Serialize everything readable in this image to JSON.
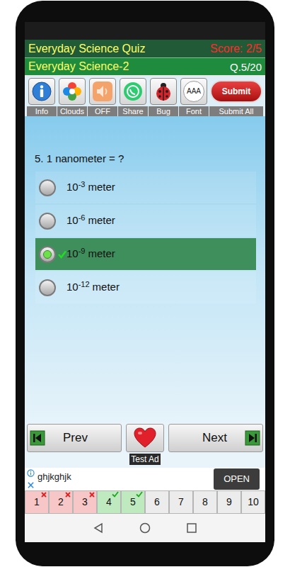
{
  "header": {
    "title": "Everyday Science Quiz",
    "score": "Score: 2/5",
    "subtitle": "Everyday Science-2",
    "progress": "Q.5/20"
  },
  "toolbar": [
    {
      "label": "Info",
      "kind": "info"
    },
    {
      "label": "Clouds",
      "kind": "clouds"
    },
    {
      "label": "OFF",
      "kind": "sound"
    },
    {
      "label": "Share",
      "kind": "share"
    },
    {
      "label": "Bug",
      "kind": "bug"
    },
    {
      "label": "Font",
      "kind": "font",
      "icon_text": "AAA"
    },
    {
      "label": "Submit All",
      "kind": "submit",
      "button_text": "Submit"
    }
  ],
  "question": {
    "text": "5. 1 nanometer = ?",
    "options": [
      {
        "base": "10",
        "exponent": "-3",
        "unit": "meter",
        "selected": false,
        "correct": false
      },
      {
        "base": "10",
        "exponent": "-6",
        "unit": "meter",
        "selected": false,
        "correct": false
      },
      {
        "base": "10",
        "exponent": "-9",
        "unit": "meter",
        "selected": true,
        "correct": true
      },
      {
        "base": "10",
        "exponent": "-12",
        "unit": "meter",
        "selected": false,
        "correct": false
      }
    ]
  },
  "nav": {
    "prev": "Prev",
    "next": "Next"
  },
  "ad": {
    "label": "Test Ad",
    "text": "ghjkghjk",
    "button": "OPEN"
  },
  "questions": [
    {
      "number": "1",
      "kind": "wrong"
    },
    {
      "number": "2",
      "kind": "wrong"
    },
    {
      "number": "3",
      "kind": "wrong"
    },
    {
      "number": "4",
      "kind": "correct"
    },
    {
      "number": "5",
      "kind": "correct"
    },
    {
      "number": "6",
      "kind": "unanswered"
    },
    {
      "number": "7",
      "kind": "unanswered"
    },
    {
      "number": "8",
      "kind": "unanswered"
    },
    {
      "number": "9",
      "kind": "unanswered"
    },
    {
      "number": "10",
      "kind": "unanswered"
    }
  ]
}
